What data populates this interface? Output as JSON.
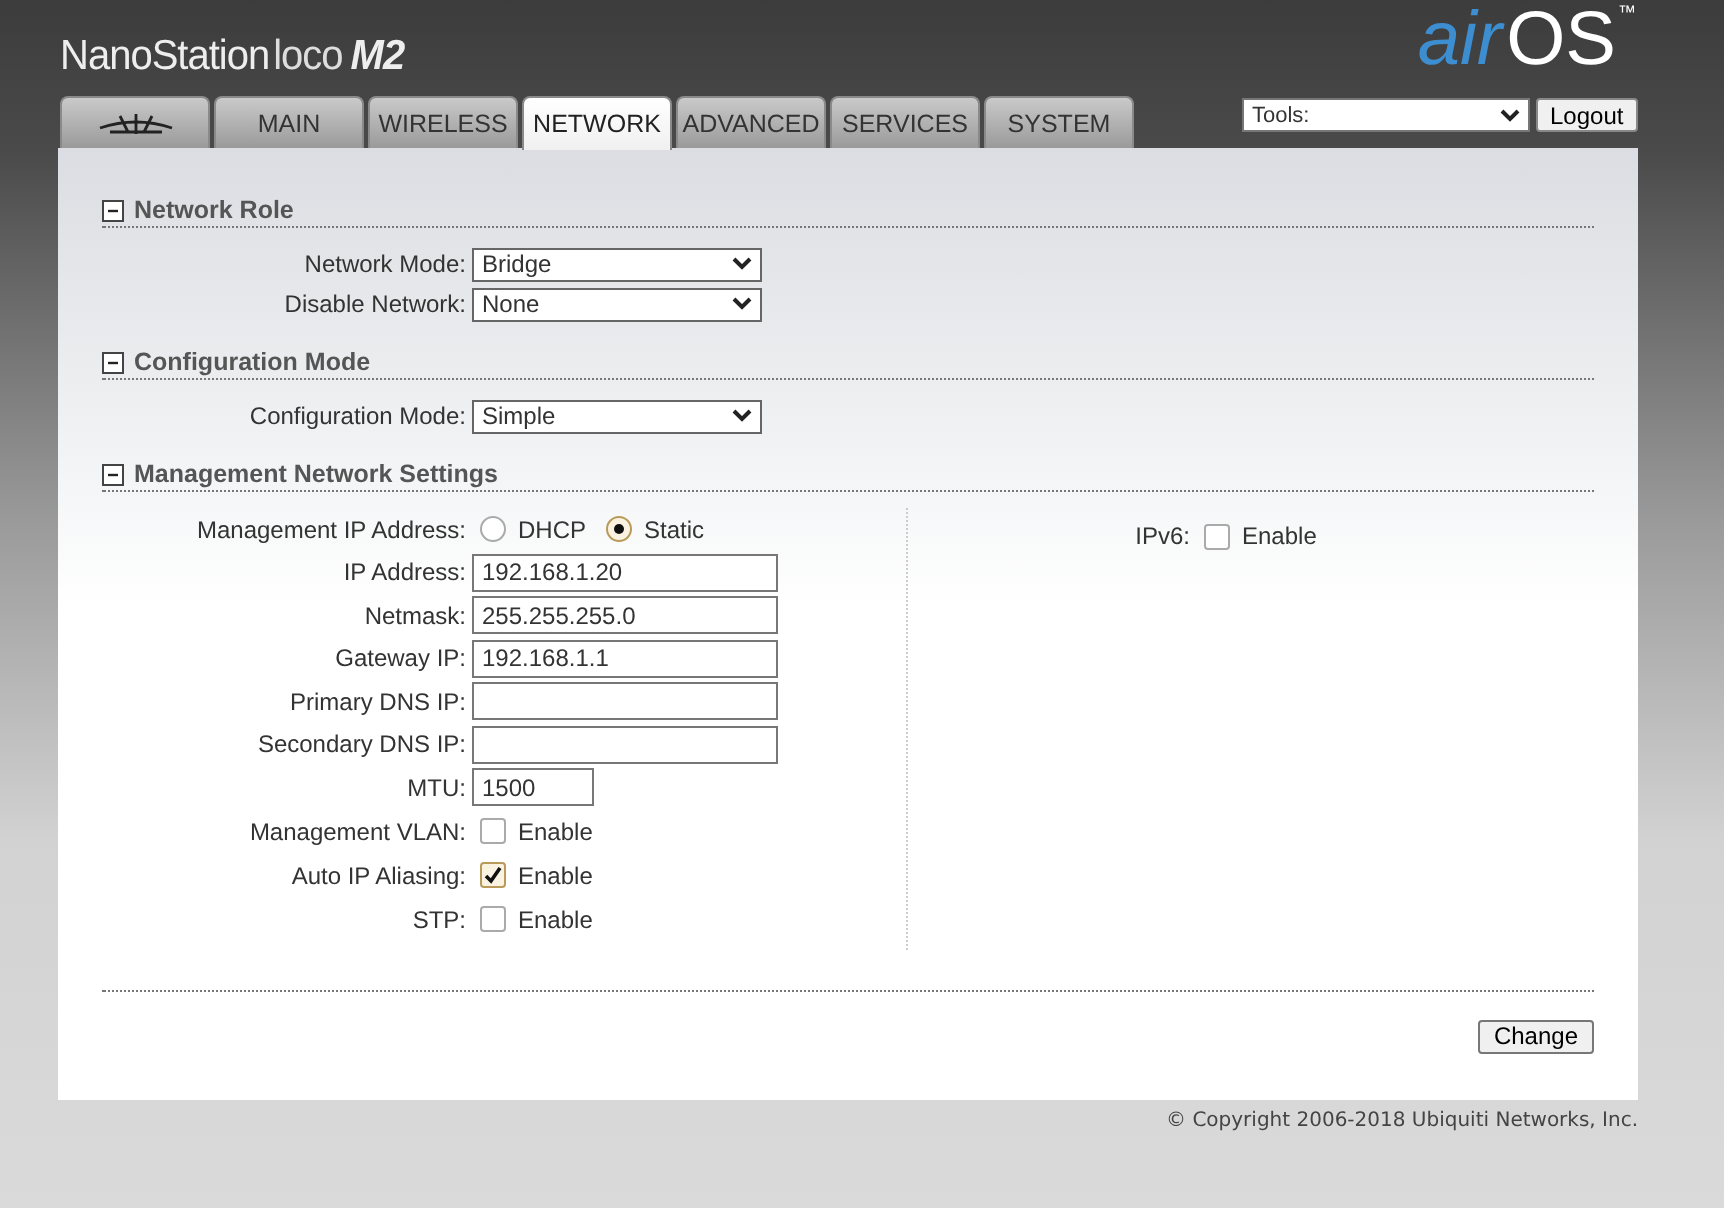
{
  "logo": {
    "product": "NanoStation",
    "variant": "loco",
    "model": "M2"
  },
  "brand": {
    "first": "air",
    "second": "OS",
    "mark": "™"
  },
  "tabs": [
    {
      "kind": "icon",
      "selected": false
    },
    {
      "kind": "text",
      "label": "MAIN",
      "selected": false
    },
    {
      "kind": "text",
      "label": "WIRELESS",
      "selected": false
    },
    {
      "kind": "text",
      "label": "NETWORK",
      "selected": true
    },
    {
      "kind": "text",
      "label": "ADVANCED",
      "selected": false
    },
    {
      "kind": "text",
      "label": "SERVICES",
      "selected": false
    },
    {
      "kind": "text",
      "label": "SYSTEM",
      "selected": false
    }
  ],
  "tools": {
    "value": "Tools:"
  },
  "logout_button": "Logout",
  "sections": [
    {
      "title": "Network Role",
      "expanded": true,
      "left": [
        {
          "kind": "select",
          "label": "Network Mode:",
          "value": "Bridge"
        },
        {
          "kind": "select",
          "label": "Disable Network:",
          "value": "None"
        }
      ]
    },
    {
      "title": "Configuration Mode",
      "expanded": true,
      "left": [
        {
          "kind": "select",
          "label": "Configuration Mode:",
          "value": "Simple"
        }
      ]
    },
    {
      "title": "Management Network Settings",
      "expanded": true,
      "left": [
        {
          "kind": "radio",
          "label": "Management IP Address:",
          "options": [
            {
              "label": "DHCP",
              "selected": false
            },
            {
              "label": "Static",
              "selected": true
            }
          ]
        },
        {
          "kind": "text",
          "label": "IP Address:",
          "value": "192.168.1.20"
        },
        {
          "kind": "text",
          "label": "Netmask:",
          "value": "255.255.255.0"
        },
        {
          "kind": "text",
          "label": "Gateway IP:",
          "value": "192.168.1.1"
        },
        {
          "kind": "text",
          "label": "Primary DNS IP:"
        },
        {
          "kind": "text",
          "label": "Secondary DNS IP:"
        },
        {
          "kind": "short",
          "label": "MTU:",
          "value": "1500"
        },
        {
          "kind": "checkbox",
          "label": "Management VLAN:",
          "option": "Enable",
          "checked": false
        },
        {
          "kind": "checkbox",
          "label": "Auto IP Aliasing:",
          "option": "Enable",
          "checked": true
        },
        {
          "kind": "checkbox",
          "label": "STP:",
          "option": "Enable",
          "checked": false
        }
      ],
      "right": [
        {
          "kind": "checkbox",
          "label": "IPv6:",
          "option": "Enable",
          "checked": false
        }
      ]
    }
  ],
  "change_button": "Change",
  "copyright": "© Copyright 2006-2018 Ubiquiti Networks, Inc."
}
